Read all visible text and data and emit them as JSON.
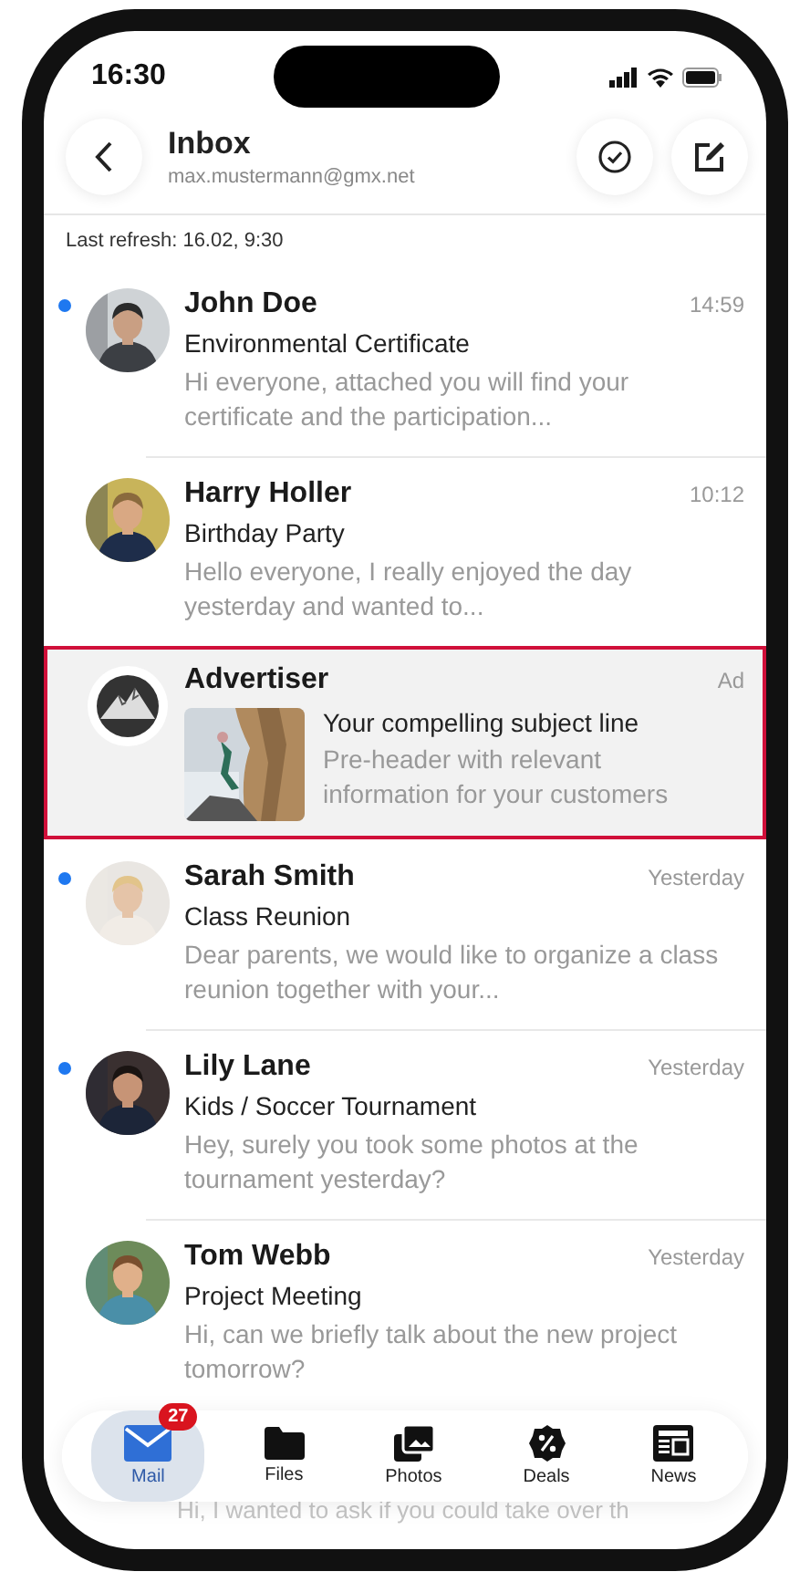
{
  "status_bar": {
    "time": "16:30"
  },
  "header": {
    "title": "Inbox",
    "account": "max.mustermann@gmx.net"
  },
  "last_refresh": "Last refresh: 16.02, 9:30",
  "messages": [
    {
      "kind": "mail",
      "sender": "John Doe",
      "time": "14:59",
      "subject": "Environmental Certificate",
      "preview": "Hi everyone, attached you will find your certificate and the participation...",
      "unread": true
    },
    {
      "kind": "mail",
      "sender": "Harry Holler",
      "time": "10:12",
      "subject": "Birthday Party",
      "preview": "Hello everyone, I really enjoyed the day yesterday and wanted to...",
      "unread": false
    },
    {
      "kind": "ad",
      "sender": "Advertiser",
      "time": "Ad",
      "subject": "Your compelling subject line",
      "preview": "Pre-header with relevant information for your customers",
      "unread": false
    },
    {
      "kind": "mail",
      "sender": "Sarah Smith",
      "time": "Yesterday",
      "subject": "Class Reunion",
      "preview": "Dear parents, we would like to organize a class reunion together with your...",
      "unread": true
    },
    {
      "kind": "mail",
      "sender": "Lily Lane",
      "time": "Yesterday",
      "subject": "Kids / Soccer Tournament",
      "preview": "Hey, surely you took some photos at the tournament yesterday?",
      "unread": true
    },
    {
      "kind": "mail",
      "sender": "Tom Webb",
      "time": "Yesterday",
      "subject": "Project Meeting",
      "preview": "Hi, can we briefly talk about the new project tomorrow?",
      "unread": false
    }
  ],
  "partial_row": {
    "preview": "Hi, I wanted to ask if you could take over th"
  },
  "tabs": [
    {
      "label": "Mail",
      "selected": true,
      "badge": "27"
    },
    {
      "label": "Files",
      "selected": false
    },
    {
      "label": "Photos",
      "selected": false
    },
    {
      "label": "Deals",
      "selected": false
    },
    {
      "label": "News",
      "selected": false
    }
  ]
}
